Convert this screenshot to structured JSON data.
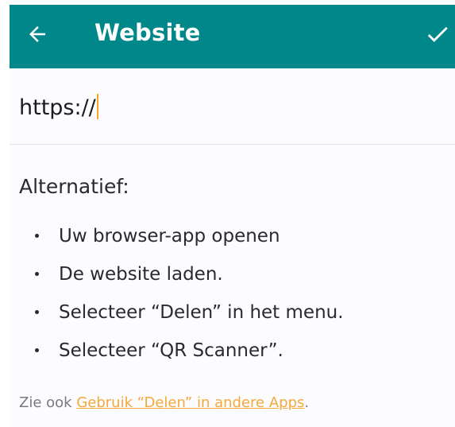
{
  "app_bar": {
    "title": "Website",
    "back_icon": "arrow-left-icon",
    "confirm_icon": "check-icon",
    "background": "#00878a"
  },
  "url_field": {
    "value": "https://"
  },
  "alternative": {
    "heading": "Alternatief:",
    "steps": [
      "Uw browser-app openen",
      "De website laden.",
      "Selecteer “Delen” in het menu.",
      "Selecteer “QR Scanner”."
    ]
  },
  "see_also": {
    "prefix": "Zie ook ",
    "link_label": "Gebruik “Delen” in andere Apps",
    "suffix": ".",
    "link_color": "#f2a93b"
  }
}
